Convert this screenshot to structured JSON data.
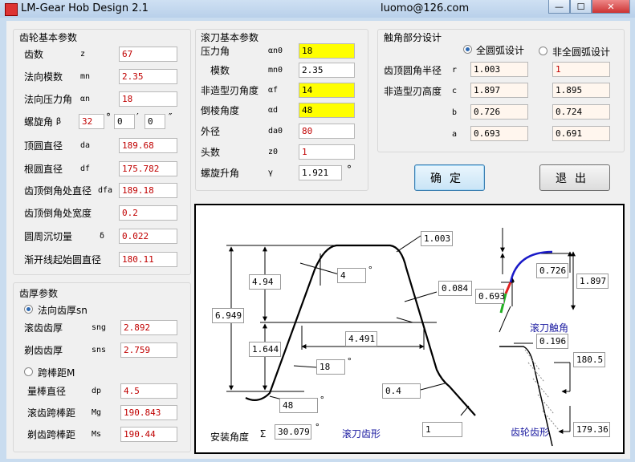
{
  "window": {
    "title": "LM-Gear Hob Design 2.1",
    "email": "luomo@126.com",
    "btn_min": "—",
    "btn_max": "☐",
    "btn_close": "✕"
  },
  "gear": {
    "title": "齿轮基本参数",
    "rows": [
      {
        "label": "齿数",
        "symbol": "z",
        "value": "67"
      },
      {
        "label": "法向模数",
        "symbol": "mn",
        "value": "2.35"
      },
      {
        "label": "法向压力角",
        "symbol": "αn",
        "value": "18"
      },
      {
        "label": "顶圆直径",
        "symbol": "da",
        "value": "189.68"
      },
      {
        "label": "根圆直径",
        "symbol": "df",
        "value": "175.782"
      },
      {
        "label": "齿顶倒角处直径",
        "symbol": "dfa",
        "value": "189.18"
      },
      {
        "label": "齿顶倒角处宽度",
        "symbol": "",
        "value": "0.2"
      },
      {
        "label": "圆周沉切量",
        "symbol": "δ",
        "value": "0.022"
      },
      {
        "label": "渐开线起始圆直径",
        "symbol": "",
        "value": "180.11"
      }
    ],
    "helix": {
      "label": "螺旋角",
      "symbol": "β",
      "deg": "32",
      "deg_unit": "°",
      "min": "0",
      "min_unit": "′",
      "sec": "0",
      "sec_unit": "″"
    }
  },
  "thickness": {
    "title": "齿厚参数",
    "opt_normal": "法向齿厚sn",
    "rows1": [
      {
        "label": "滚齿齿厚",
        "symbol": "sng",
        "value": "2.892"
      },
      {
        "label": "剃齿齿厚",
        "symbol": "sns",
        "value": "2.759"
      }
    ],
    "opt_pin": "跨棒距M",
    "rows2": [
      {
        "label": "量棒直径",
        "symbol": "dp",
        "value": "4.5"
      },
      {
        "label": "滚齿跨棒距",
        "symbol": "Mg",
        "value": "190.843"
      },
      {
        "label": "剃齿跨棒距",
        "symbol": "Ms",
        "value": "190.44"
      }
    ]
  },
  "hob": {
    "title": "滚刀基本参数",
    "rows": [
      {
        "label": "压力角",
        "symbol": "αn0",
        "value": "18"
      },
      {
        "label": "模数",
        "symbol": "mn0",
        "value": "2.35"
      },
      {
        "label": "非造型刃角度",
        "symbol": "αf",
        "value": "14"
      },
      {
        "label": "倒棱角度",
        "symbol": "αd",
        "value": "48"
      },
      {
        "label": "外径",
        "symbol": "da0",
        "value": "80"
      },
      {
        "label": "头数",
        "symbol": "z0",
        "value": "1"
      },
      {
        "label": "螺旋升角",
        "symbol": "γ",
        "value": "1.921"
      }
    ],
    "deg_unit": "°"
  },
  "tip": {
    "title": "触角部分设计",
    "opt_full": "全圆弧设计",
    "opt_nonfull": "非全圆弧设计",
    "rows": [
      {
        "label": "齿顶圆角半径",
        "symbol": "r",
        "v1": "1.003",
        "v2": "1"
      },
      {
        "label": "非造型刃高度",
        "symbol": "c",
        "v1": "1.897",
        "v2": "1.895"
      },
      {
        "label": "",
        "symbol": "b",
        "v1": "0.726",
        "v2": "0.724"
      },
      {
        "label": "",
        "symbol": "a",
        "v1": "0.693",
        "v2": "0.691"
      }
    ]
  },
  "buttons": {
    "ok": "确定",
    "exit": "退出"
  },
  "drawing": {
    "dims": {
      "r": "1.003",
      "chamfer": "0.084",
      "h_upper": "4.94",
      "total_h": "6.949",
      "h_lower": "1.644",
      "width": "4.491",
      "ang_top": "4",
      "ang_18": "18",
      "ang_48": "48",
      "d04": "0.4",
      "one": "1"
    },
    "deg": "°",
    "install_label": "安装角度",
    "install_symbol": "Σ",
    "install_value": "30.079",
    "hob_profile_caption": "滚刀齿形",
    "tip_caption": "滚刀触角",
    "tip_b": "0.726",
    "tip_c": "1.897",
    "tip_a": "0.693",
    "gear_caption": "齿轮齿形",
    "gear_chamfer": "0.196",
    "gear_top": "180.5",
    "gear_bottom": "179.36",
    "colors": {
      "arc": "#1a1ac8",
      "red": "#e02020",
      "green": "#22b022"
    }
  }
}
